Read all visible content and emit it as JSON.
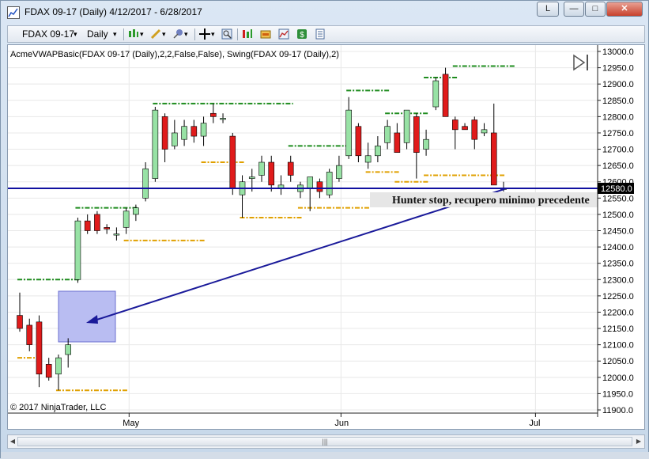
{
  "window": {
    "title": "FDAX 09-17 (Daily)  4/12/2017 - 6/28/2017",
    "caption_button": "L",
    "min_symbol": "—",
    "max_symbol": "□",
    "close_symbol": "✕"
  },
  "toolbar": {
    "instrument": "FDAX 09-17",
    "period": "Daily",
    "dropdown_arrow": "▾"
  },
  "chart": {
    "indicator_label": "AcmeVWAPBasic(FDAX 09-17 (Daily),2,2,False,False), Swing(FDAX 09-17 (Daily),2)",
    "copyright": "© 2017 NinjaTrader, LLC",
    "annotation_text": "Hunter stop, recupero minimo precedente",
    "current_price_label": "12580.0",
    "colors": {
      "up": "#98e2a5",
      "down": "#e01b1b",
      "swing_high": "#1e8c1e",
      "swing_low": "#e0a000",
      "line": "#1010a0",
      "box": "#b9bdf2"
    }
  },
  "scrollbar": {
    "grip": "|||",
    "left_arrow": "◀",
    "right_arrow": "▶"
  },
  "chart_data": {
    "type": "candlestick",
    "x_labels": [
      "May",
      "Jun",
      "Jul"
    ],
    "y_ticks": [
      11900.0,
      11950.0,
      12000.0,
      12050.0,
      12100.0,
      12150.0,
      12200.0,
      12250.0,
      12300.0,
      12350.0,
      12400.0,
      12450.0,
      12500.0,
      12550.0,
      12600.0,
      12650.0,
      12700.0,
      12750.0,
      12800.0,
      12850.0,
      12900.0,
      12950.0,
      13000.0
    ],
    "ylim": [
      11900,
      13000
    ],
    "horizontal_line": 12580,
    "candles": [
      {
        "o": 12190,
        "h": 12260,
        "l": 12140,
        "c": 12150
      },
      {
        "o": 12160,
        "h": 12180,
        "l": 12080,
        "c": 12100
      },
      {
        "o": 12170,
        "h": 12190,
        "l": 11970,
        "c": 12010
      },
      {
        "o": 12040,
        "h": 12060,
        "l": 11990,
        "c": 12000
      },
      {
        "o": 12010,
        "h": 12070,
        "l": 11960,
        "c": 12060
      },
      {
        "o": 12070,
        "h": 12120,
        "l": 12030,
        "c": 12100
      },
      {
        "o": 12300,
        "h": 12490,
        "l": 12290,
        "c": 12480
      },
      {
        "o": 12480,
        "h": 12500,
        "l": 12440,
        "c": 12450
      },
      {
        "o": 12500,
        "h": 12510,
        "l": 12440,
        "c": 12450
      },
      {
        "o": 12460,
        "h": 12470,
        "l": 12440,
        "c": 12455
      },
      {
        "o": 12440,
        "h": 12460,
        "l": 12420,
        "c": 12440
      },
      {
        "o": 12460,
        "h": 12520,
        "l": 12440,
        "c": 12510
      },
      {
        "o": 12500,
        "h": 12530,
        "l": 12480,
        "c": 12520
      },
      {
        "o": 12550,
        "h": 12660,
        "l": 12540,
        "c": 12640
      },
      {
        "o": 12610,
        "h": 12830,
        "l": 12600,
        "c": 12820
      },
      {
        "o": 12800,
        "h": 12810,
        "l": 12660,
        "c": 12700
      },
      {
        "o": 12710,
        "h": 12790,
        "l": 12700,
        "c": 12750
      },
      {
        "o": 12730,
        "h": 12790,
        "l": 12710,
        "c": 12770
      },
      {
        "o": 12770,
        "h": 12790,
        "l": 12720,
        "c": 12740
      },
      {
        "o": 12740,
        "h": 12800,
        "l": 12710,
        "c": 12780
      },
      {
        "o": 12810,
        "h": 12840,
        "l": 12780,
        "c": 12800
      },
      {
        "o": 12795,
        "h": 12810,
        "l": 12780,
        "c": 12795
      },
      {
        "o": 12740,
        "h": 12750,
        "l": 12560,
        "c": 12580
      },
      {
        "o": 12560,
        "h": 12620,
        "l": 12490,
        "c": 12600
      },
      {
        "o": 12610,
        "h": 12640,
        "l": 12570,
        "c": 12615
      },
      {
        "o": 12620,
        "h": 12680,
        "l": 12600,
        "c": 12660
      },
      {
        "o": 12660,
        "h": 12680,
        "l": 12570,
        "c": 12590
      },
      {
        "o": 12580,
        "h": 12620,
        "l": 12560,
        "c": 12590
      },
      {
        "o": 12660,
        "h": 12680,
        "l": 12600,
        "c": 12620
      },
      {
        "o": 12570,
        "h": 12600,
        "l": 12550,
        "c": 12590
      },
      {
        "o": 12580,
        "h": 12600,
        "l": 12510,
        "c": 12615
      },
      {
        "o": 12600,
        "h": 12610,
        "l": 12550,
        "c": 12570
      },
      {
        "o": 12560,
        "h": 12640,
        "l": 12550,
        "c": 12630
      },
      {
        "o": 12610,
        "h": 12680,
        "l": 12600,
        "c": 12650
      },
      {
        "o": 12680,
        "h": 12860,
        "l": 12670,
        "c": 12820
      },
      {
        "o": 12770,
        "h": 12780,
        "l": 12660,
        "c": 12680
      },
      {
        "o": 12660,
        "h": 12720,
        "l": 12640,
        "c": 12680
      },
      {
        "o": 12680,
        "h": 12740,
        "l": 12660,
        "c": 12710
      },
      {
        "o": 12720,
        "h": 12790,
        "l": 12700,
        "c": 12770
      },
      {
        "o": 12750,
        "h": 12780,
        "l": 12690,
        "c": 12690
      },
      {
        "o": 12720,
        "h": 12820,
        "l": 12700,
        "c": 12820
      },
      {
        "o": 12800,
        "h": 12810,
        "l": 12610,
        "c": 12690
      },
      {
        "o": 12700,
        "h": 12760,
        "l": 12680,
        "c": 12730
      },
      {
        "o": 12830,
        "h": 12920,
        "l": 12820,
        "c": 12910
      },
      {
        "o": 12930,
        "h": 12950,
        "l": 12800,
        "c": 12800
      },
      {
        "o": 12790,
        "h": 12800,
        "l": 12700,
        "c": 12760
      },
      {
        "o": 12770,
        "h": 12780,
        "l": 12760,
        "c": 12760
      },
      {
        "o": 12790,
        "h": 12800,
        "l": 12700,
        "c": 12730
      },
      {
        "o": 12750,
        "h": 12780,
        "l": 12740,
        "c": 12760
      },
      {
        "o": 12750,
        "h": 12840,
        "l": 12590,
        "c": 12590
      },
      {
        "o": 12580,
        "h": 12600,
        "l": 12570,
        "c": 12580
      }
    ]
  }
}
